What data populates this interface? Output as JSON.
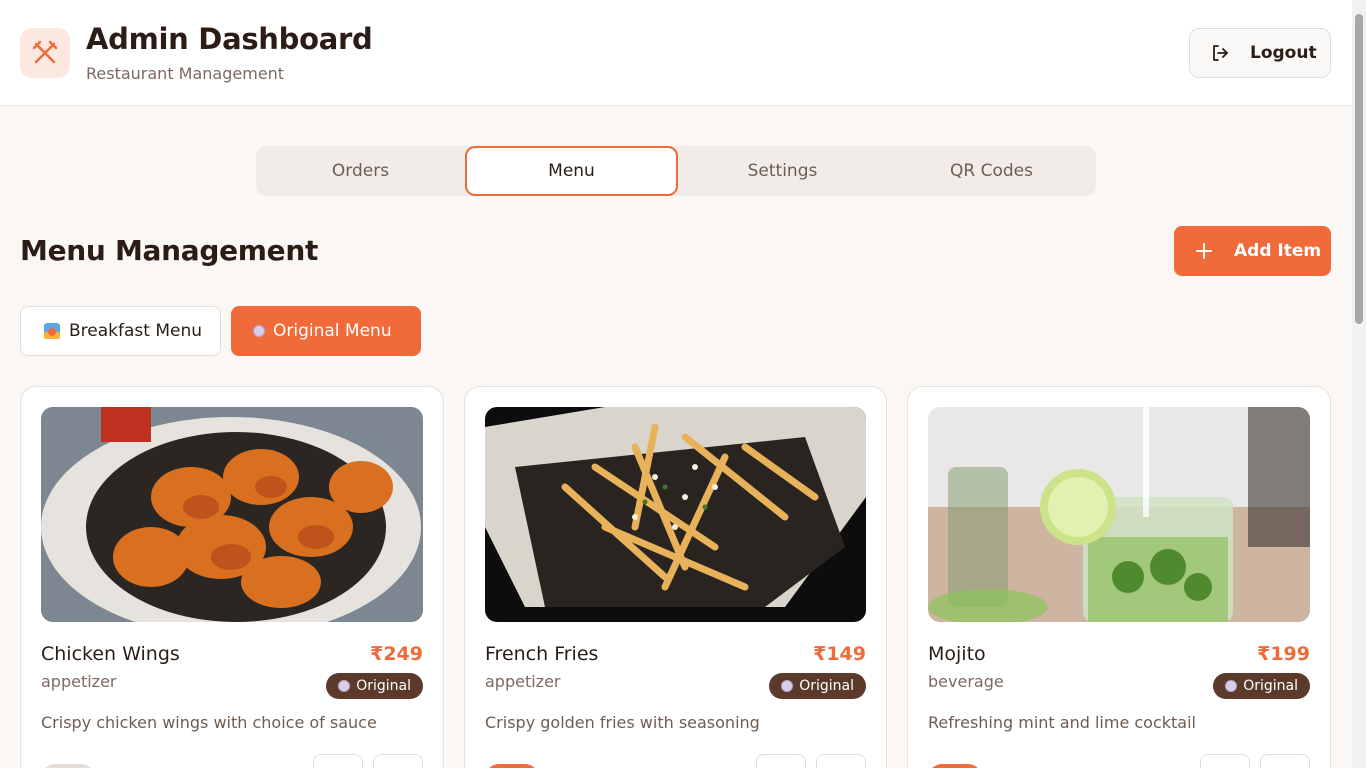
{
  "header": {
    "title": "Admin Dashboard",
    "subtitle": "Restaurant Management",
    "logout_label": "Logout"
  },
  "tabs": [
    {
      "label": "Orders",
      "active": false
    },
    {
      "label": "Menu",
      "active": true
    },
    {
      "label": "Settings",
      "active": false
    },
    {
      "label": "QR Codes",
      "active": false
    }
  ],
  "section": {
    "title": "Menu Management",
    "add_label": "Add Item"
  },
  "menu_types": {
    "breakfast_label": "Breakfast Menu",
    "original_label": "Original Menu",
    "selected": "Original Menu"
  },
  "items": [
    {
      "name": "Chicken Wings",
      "price": "₹249",
      "category": "appetizer",
      "badge": "Original",
      "description": "Crispy chicken wings with choice of sauce",
      "available": false
    },
    {
      "name": "French Fries",
      "price": "₹149",
      "category": "appetizer",
      "badge": "Original",
      "description": "Crispy golden fries with seasoning",
      "available": true
    },
    {
      "name": "Mojito",
      "price": "₹199",
      "category": "beverage",
      "badge": "Original",
      "description": "Refreshing mint and lime cocktail",
      "available": true
    }
  ],
  "colors": {
    "accent": "#f06a3a",
    "badge_bg": "#5b3a2c",
    "text_dark": "#2b1d16",
    "text_muted": "#7b6a60"
  }
}
